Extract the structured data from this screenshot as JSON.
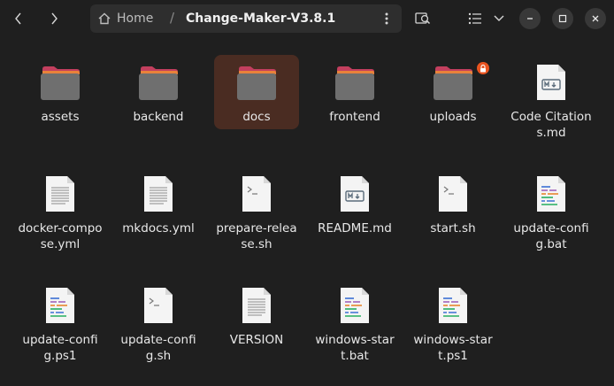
{
  "window": {
    "path": {
      "home_label": "Home",
      "current": "Change-Maker-V3.8.1"
    }
  },
  "files": [
    {
      "name": "assets",
      "kind": "folder"
    },
    {
      "name": "backend",
      "kind": "folder"
    },
    {
      "name": "docs",
      "kind": "folder",
      "selected": true
    },
    {
      "name": "frontend",
      "kind": "folder"
    },
    {
      "name": "uploads",
      "kind": "folder",
      "locked": true
    },
    {
      "name": "Code Citations.md",
      "kind": "markdown"
    },
    {
      "name": "docker-compose.yml",
      "kind": "text"
    },
    {
      "name": "mkdocs.yml",
      "kind": "text"
    },
    {
      "name": "prepare-release.sh",
      "kind": "script"
    },
    {
      "name": "README.md",
      "kind": "markdown"
    },
    {
      "name": "start.sh",
      "kind": "script"
    },
    {
      "name": "update-config.bat",
      "kind": "code"
    },
    {
      "name": "update-config.ps1",
      "kind": "code"
    },
    {
      "name": "update-config.sh",
      "kind": "script"
    },
    {
      "name": "VERSION",
      "kind": "text"
    },
    {
      "name": "windows-start.bat",
      "kind": "code"
    },
    {
      "name": "windows-start.ps1",
      "kind": "code"
    }
  ],
  "colors": {
    "accent": "#e95420",
    "selection": "#4a2c22",
    "background": "#1f1f1f"
  }
}
